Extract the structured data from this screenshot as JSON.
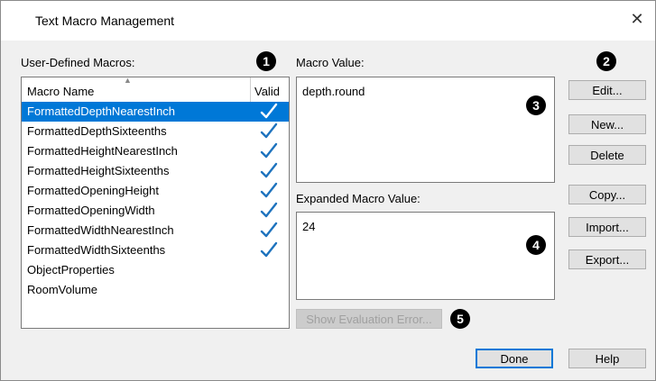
{
  "window": {
    "title": "Text Macro Management",
    "close_glyph": "✕"
  },
  "labels": {
    "user_defined_macros": "User-Defined Macros:",
    "macro_value": "Macro Value:",
    "expanded_macro_value": "Expanded Macro Value:"
  },
  "list": {
    "col_name": "Macro Name",
    "col_valid": "Valid",
    "selected_index": 0,
    "rows": [
      {
        "name": "FormattedDepthNearestInch",
        "valid": true
      },
      {
        "name": "FormattedDepthSixteenths",
        "valid": true
      },
      {
        "name": "FormattedHeightNearestInch",
        "valid": true
      },
      {
        "name": "FormattedHeightSixteenths",
        "valid": true
      },
      {
        "name": "FormattedOpeningHeight",
        "valid": true
      },
      {
        "name": "FormattedOpeningWidth",
        "valid": true
      },
      {
        "name": "FormattedWidthNearestInch",
        "valid": true
      },
      {
        "name": "FormattedWidthSixteenths",
        "valid": true
      },
      {
        "name": "ObjectProperties",
        "valid": false
      },
      {
        "name": "RoomVolume",
        "valid": false
      }
    ]
  },
  "macro_value": "depth.round",
  "expanded_value": "24",
  "buttons": {
    "edit": "Edit...",
    "new": "New...",
    "delete": "Delete",
    "copy": "Copy...",
    "import": "Import...",
    "export": "Export...",
    "show_eval_error": "Show Evaluation Error...",
    "done": "Done",
    "help": "Help"
  },
  "badges": {
    "b1": "1",
    "b2": "2",
    "b3": "3",
    "b4": "4",
    "b5": "5"
  },
  "colors": {
    "selection": "#0078d7",
    "check": "#1e73be"
  }
}
